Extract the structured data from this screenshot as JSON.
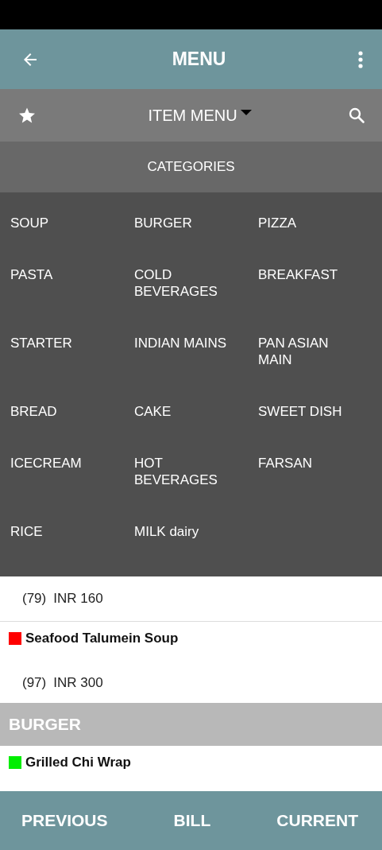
{
  "app_bar": {
    "title": "MENU"
  },
  "toolbar": {
    "title": "ITEM MENU"
  },
  "categories": {
    "title": "CATEGORIES",
    "items": [
      "SOUP",
      "BURGER",
      "PIZZA",
      "PASTA",
      "COLD BEVERAGES",
      "BREAKFAST",
      "STARTER",
      "INDIAN MAINS",
      "PAN ASIAN MAIN",
      "BREAD",
      "CAKE",
      "SWEET DISH",
      "ICECREAM",
      "HOT BEVERAGES",
      "FARSAN",
      "RICE",
      "MILK dairy"
    ]
  },
  "list": [
    {
      "kind": "price",
      "count": "(79)",
      "price": "INR 160"
    },
    {
      "kind": "item",
      "name": "Seafood Talumein Soup",
      "color": "#ff0000",
      "count": "(97)",
      "price": "INR 300"
    },
    {
      "kind": "header",
      "name": "BURGER"
    },
    {
      "kind": "item",
      "name": "Grilled Chi Wrap",
      "color": "#00ee00"
    }
  ],
  "bottom_bar": [
    "PREVIOUS",
    "BILL",
    "CURRENT"
  ]
}
